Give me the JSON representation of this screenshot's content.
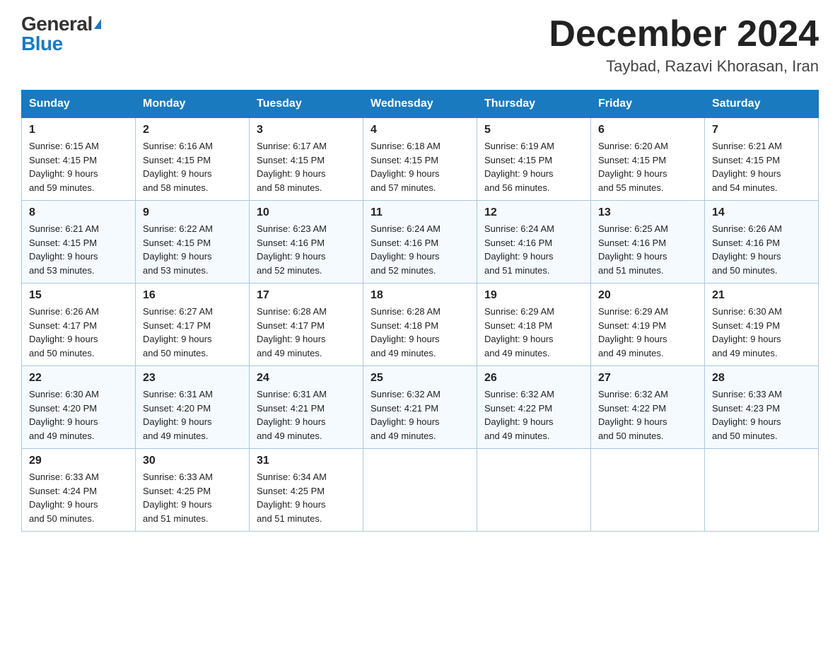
{
  "header": {
    "logo_general": "General",
    "logo_blue": "Blue",
    "month_title": "December 2024",
    "location": "Taybad, Razavi Khorasan, Iran"
  },
  "weekdays": [
    "Sunday",
    "Monday",
    "Tuesday",
    "Wednesday",
    "Thursday",
    "Friday",
    "Saturday"
  ],
  "weeks": [
    [
      {
        "day": "1",
        "sunrise": "6:15 AM",
        "sunset": "4:15 PM",
        "daylight": "9 hours and 59 minutes."
      },
      {
        "day": "2",
        "sunrise": "6:16 AM",
        "sunset": "4:15 PM",
        "daylight": "9 hours and 58 minutes."
      },
      {
        "day": "3",
        "sunrise": "6:17 AM",
        "sunset": "4:15 PM",
        "daylight": "9 hours and 58 minutes."
      },
      {
        "day": "4",
        "sunrise": "6:18 AM",
        "sunset": "4:15 PM",
        "daylight": "9 hours and 57 minutes."
      },
      {
        "day": "5",
        "sunrise": "6:19 AM",
        "sunset": "4:15 PM",
        "daylight": "9 hours and 56 minutes."
      },
      {
        "day": "6",
        "sunrise": "6:20 AM",
        "sunset": "4:15 PM",
        "daylight": "9 hours and 55 minutes."
      },
      {
        "day": "7",
        "sunrise": "6:21 AM",
        "sunset": "4:15 PM",
        "daylight": "9 hours and 54 minutes."
      }
    ],
    [
      {
        "day": "8",
        "sunrise": "6:21 AM",
        "sunset": "4:15 PM",
        "daylight": "9 hours and 53 minutes."
      },
      {
        "day": "9",
        "sunrise": "6:22 AM",
        "sunset": "4:15 PM",
        "daylight": "9 hours and 53 minutes."
      },
      {
        "day": "10",
        "sunrise": "6:23 AM",
        "sunset": "4:16 PM",
        "daylight": "9 hours and 52 minutes."
      },
      {
        "day": "11",
        "sunrise": "6:24 AM",
        "sunset": "4:16 PM",
        "daylight": "9 hours and 52 minutes."
      },
      {
        "day": "12",
        "sunrise": "6:24 AM",
        "sunset": "4:16 PM",
        "daylight": "9 hours and 51 minutes."
      },
      {
        "day": "13",
        "sunrise": "6:25 AM",
        "sunset": "4:16 PM",
        "daylight": "9 hours and 51 minutes."
      },
      {
        "day": "14",
        "sunrise": "6:26 AM",
        "sunset": "4:16 PM",
        "daylight": "9 hours and 50 minutes."
      }
    ],
    [
      {
        "day": "15",
        "sunrise": "6:26 AM",
        "sunset": "4:17 PM",
        "daylight": "9 hours and 50 minutes."
      },
      {
        "day": "16",
        "sunrise": "6:27 AM",
        "sunset": "4:17 PM",
        "daylight": "9 hours and 50 minutes."
      },
      {
        "day": "17",
        "sunrise": "6:28 AM",
        "sunset": "4:17 PM",
        "daylight": "9 hours and 49 minutes."
      },
      {
        "day": "18",
        "sunrise": "6:28 AM",
        "sunset": "4:18 PM",
        "daylight": "9 hours and 49 minutes."
      },
      {
        "day": "19",
        "sunrise": "6:29 AM",
        "sunset": "4:18 PM",
        "daylight": "9 hours and 49 minutes."
      },
      {
        "day": "20",
        "sunrise": "6:29 AM",
        "sunset": "4:19 PM",
        "daylight": "9 hours and 49 minutes."
      },
      {
        "day": "21",
        "sunrise": "6:30 AM",
        "sunset": "4:19 PM",
        "daylight": "9 hours and 49 minutes."
      }
    ],
    [
      {
        "day": "22",
        "sunrise": "6:30 AM",
        "sunset": "4:20 PM",
        "daylight": "9 hours and 49 minutes."
      },
      {
        "day": "23",
        "sunrise": "6:31 AM",
        "sunset": "4:20 PM",
        "daylight": "9 hours and 49 minutes."
      },
      {
        "day": "24",
        "sunrise": "6:31 AM",
        "sunset": "4:21 PM",
        "daylight": "9 hours and 49 minutes."
      },
      {
        "day": "25",
        "sunrise": "6:32 AM",
        "sunset": "4:21 PM",
        "daylight": "9 hours and 49 minutes."
      },
      {
        "day": "26",
        "sunrise": "6:32 AM",
        "sunset": "4:22 PM",
        "daylight": "9 hours and 49 minutes."
      },
      {
        "day": "27",
        "sunrise": "6:32 AM",
        "sunset": "4:22 PM",
        "daylight": "9 hours and 50 minutes."
      },
      {
        "day": "28",
        "sunrise": "6:33 AM",
        "sunset": "4:23 PM",
        "daylight": "9 hours and 50 minutes."
      }
    ],
    [
      {
        "day": "29",
        "sunrise": "6:33 AM",
        "sunset": "4:24 PM",
        "daylight": "9 hours and 50 minutes."
      },
      {
        "day": "30",
        "sunrise": "6:33 AM",
        "sunset": "4:25 PM",
        "daylight": "9 hours and 51 minutes."
      },
      {
        "day": "31",
        "sunrise": "6:34 AM",
        "sunset": "4:25 PM",
        "daylight": "9 hours and 51 minutes."
      },
      null,
      null,
      null,
      null
    ]
  ],
  "labels": {
    "sunrise": "Sunrise:",
    "sunset": "Sunset:",
    "daylight": "Daylight:"
  }
}
